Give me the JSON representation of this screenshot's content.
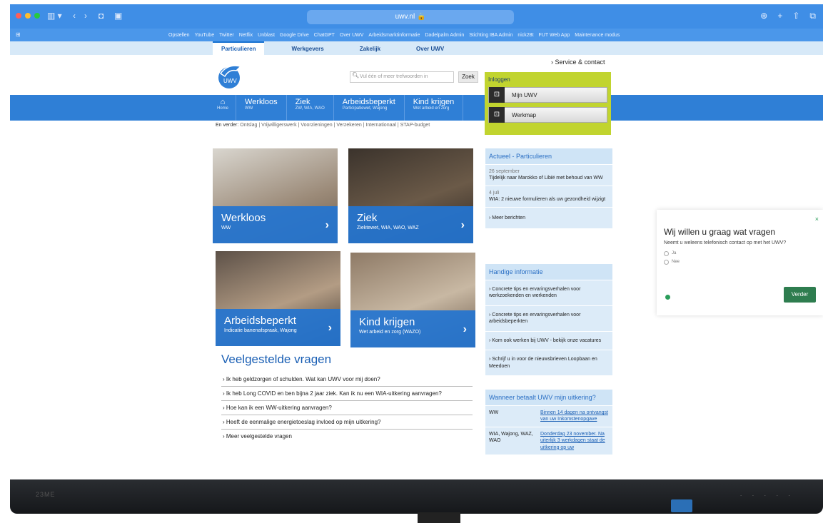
{
  "browser": {
    "url": "uwv.nl",
    "bookmarks_left": "⊞",
    "bookmarks": [
      "Opstellen",
      "YouTube",
      "Twitter",
      "Netflix",
      "Unblast",
      "Google Drive",
      "ChatGPT",
      "Over UWV",
      "Arbeidsmarktinformatie",
      "Dadelpalm Admin",
      "Stichting IBA Admin",
      "nick28t",
      "FUT Web App",
      "Maintenance modus"
    ]
  },
  "site": {
    "topnav": [
      "Particulieren",
      "Werkgevers",
      "Zakelijk",
      "Over UWV"
    ],
    "logo_text": "UWV",
    "service_link": "› Service & contact",
    "search_placeholder": "Vul één of meer trefwoorden in",
    "search_button": "Zoek",
    "login": {
      "title": "Inloggen",
      "buttons": [
        "Mijn UWV",
        "Werkmap"
      ]
    },
    "mainnav": {
      "home": "Home",
      "items": [
        {
          "title": "Werkloos",
          "sub": "WW"
        },
        {
          "title": "Ziek",
          "sub": "ZW, WIA, WAO"
        },
        {
          "title": "Arbeidsbeperkt",
          "sub": "Participatiewet, Wajong"
        },
        {
          "title": "Kind krijgen",
          "sub": "Wet arbeid en zorg"
        }
      ]
    },
    "subnav": {
      "label": "En verder:",
      "items": "Ontslag | Vrijwilligerswerk | Voorzieningen | Verzekeren | Internationaal | STAP-budget"
    },
    "tiles": [
      {
        "title": "Werkloos",
        "sub": "WW"
      },
      {
        "title": "Ziek",
        "sub": "Ziektewet, WIA, WAO, WAZ"
      },
      {
        "title": "Arbeidsbeperkt",
        "sub": "Indicatie banenafspraak, Wajong"
      },
      {
        "title": "Kind krijgen",
        "sub": "Wet arbeid en zorg (WAZO)"
      }
    ],
    "faq": {
      "title": "Veelgestelde vragen",
      "items": [
        "Ik heb geldzorgen of schulden. Wat kan UWV voor mij doen?",
        "Ik heb Long COVID en ben bijna 2 jaar ziek. Kan ik nu een WIA-uitkering aanvragen?",
        "Hoe kan ik een WW-uitkering aanvragen?",
        "Heeft de eenmalige energietoeslag invloed op mijn uitkering?",
        "Meer veelgestelde vragen"
      ]
    },
    "actueel": {
      "title": "Actueel - Particulieren",
      "items": [
        {
          "date": "26 september",
          "text": "Tijdelijk naar Marokko of Libië met behoud van WW"
        },
        {
          "date": "4 juli",
          "text": "WIA: 2 nieuwe formulieren als uw gezondheid wijzigt"
        }
      ],
      "more": "Meer berichten"
    },
    "handig": {
      "title": "Handige informatie",
      "items": [
        "Concrete tips en ervaringsverhalen voor werkzoekenden en werkenden",
        "Concrete tips en ervaringsverhalen voor arbeidsbeperkten",
        "Kom ook werken bij UWV - bekijk onze vacatures",
        "Schrijf u in voor de nieuwsbrieven Loopbaan en Meedoen"
      ]
    },
    "betaalt": {
      "title": "Wanneer betaalt UWV mijn uitkering?",
      "rows": [
        {
          "k": "WW",
          "v": "Binnen 14 dagen na ontvangst van uw Inkomstenopgave"
        },
        {
          "k": "WIA, Wajong, WAZ, WAO",
          "v": "Donderdag 23 november. Na uiterlijk 3 werkdagen staat de uitkering op uw"
        }
      ]
    },
    "survey": {
      "title": "Wij willen u graag wat vragen",
      "question": "Neemt u weleens telefonisch contact op met het UWV?",
      "options": [
        "Ja",
        "Nee"
      ],
      "button": "Verder",
      "close": "×"
    }
  },
  "monitor": {
    "brand": "23ME"
  }
}
